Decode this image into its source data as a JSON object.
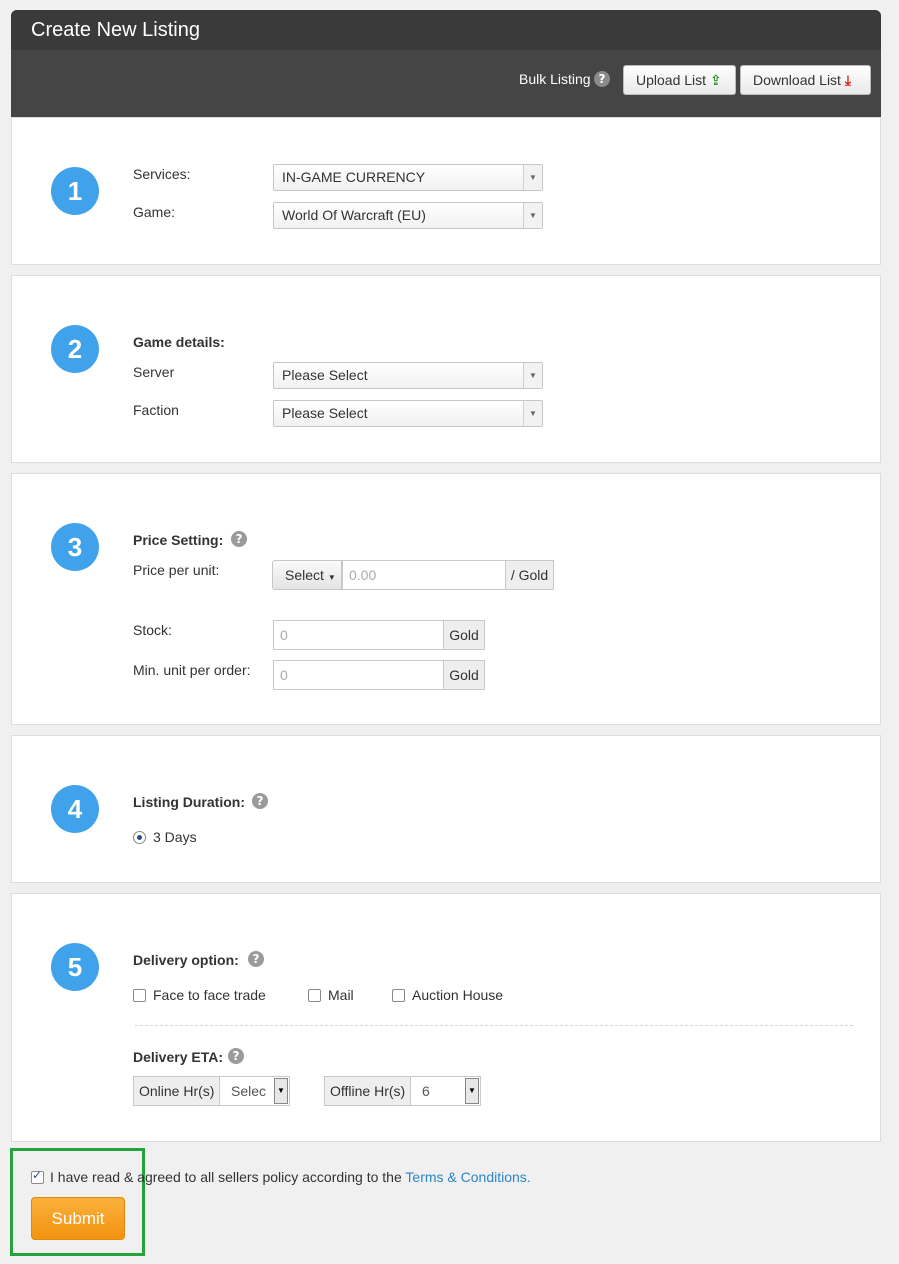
{
  "header": {
    "title": "Create New Listing",
    "bulk_label": "Bulk Listing",
    "upload_label": "Upload List",
    "download_label": "Download List"
  },
  "step1": {
    "number": "1",
    "services_label": "Services:",
    "services_value": "IN-GAME CURRENCY",
    "game_label": "Game:",
    "game_value": "World Of Warcraft (EU)"
  },
  "step2": {
    "number": "2",
    "heading": "Game details:",
    "server_label": "Server",
    "server_value": "Please Select",
    "faction_label": "Faction",
    "faction_value": "Please Select"
  },
  "step3": {
    "number": "3",
    "heading": "Price Setting:",
    "price_label": "Price per unit:",
    "currency_select": "Select",
    "price_placeholder": "0.00",
    "price_unit": "/ Gold",
    "stock_label": "Stock:",
    "stock_placeholder": "0",
    "stock_unit": "Gold",
    "min_label": "Min. unit per order:",
    "min_placeholder": "0",
    "min_unit": "Gold"
  },
  "step4": {
    "number": "4",
    "heading": "Listing Duration:",
    "option": "3 Days"
  },
  "step5": {
    "number": "5",
    "heading": "Delivery option:",
    "options": [
      "Face to face trade",
      "Mail",
      "Auction House"
    ],
    "eta_heading": "Delivery ETA:",
    "online_label": "Online Hr(s)",
    "online_value": "Selec",
    "offline_label": "Offline Hr(s)",
    "offline_value": "6"
  },
  "footer": {
    "agree_text": "I have read & agreed to all sellers policy according to the ",
    "terms_link": "Terms & Conditions.",
    "submit_label": "Submit",
    "agree_checked": true
  },
  "colors": {
    "accent_blue": "#3fa2ea",
    "header_bg": "#454545",
    "submit_orange": "#f39310",
    "highlight_green": "#26a23a",
    "link_blue": "#2a86c9"
  },
  "icons": [
    "help-icon",
    "upload-icon",
    "download-icon",
    "chevron-down-icon"
  ]
}
